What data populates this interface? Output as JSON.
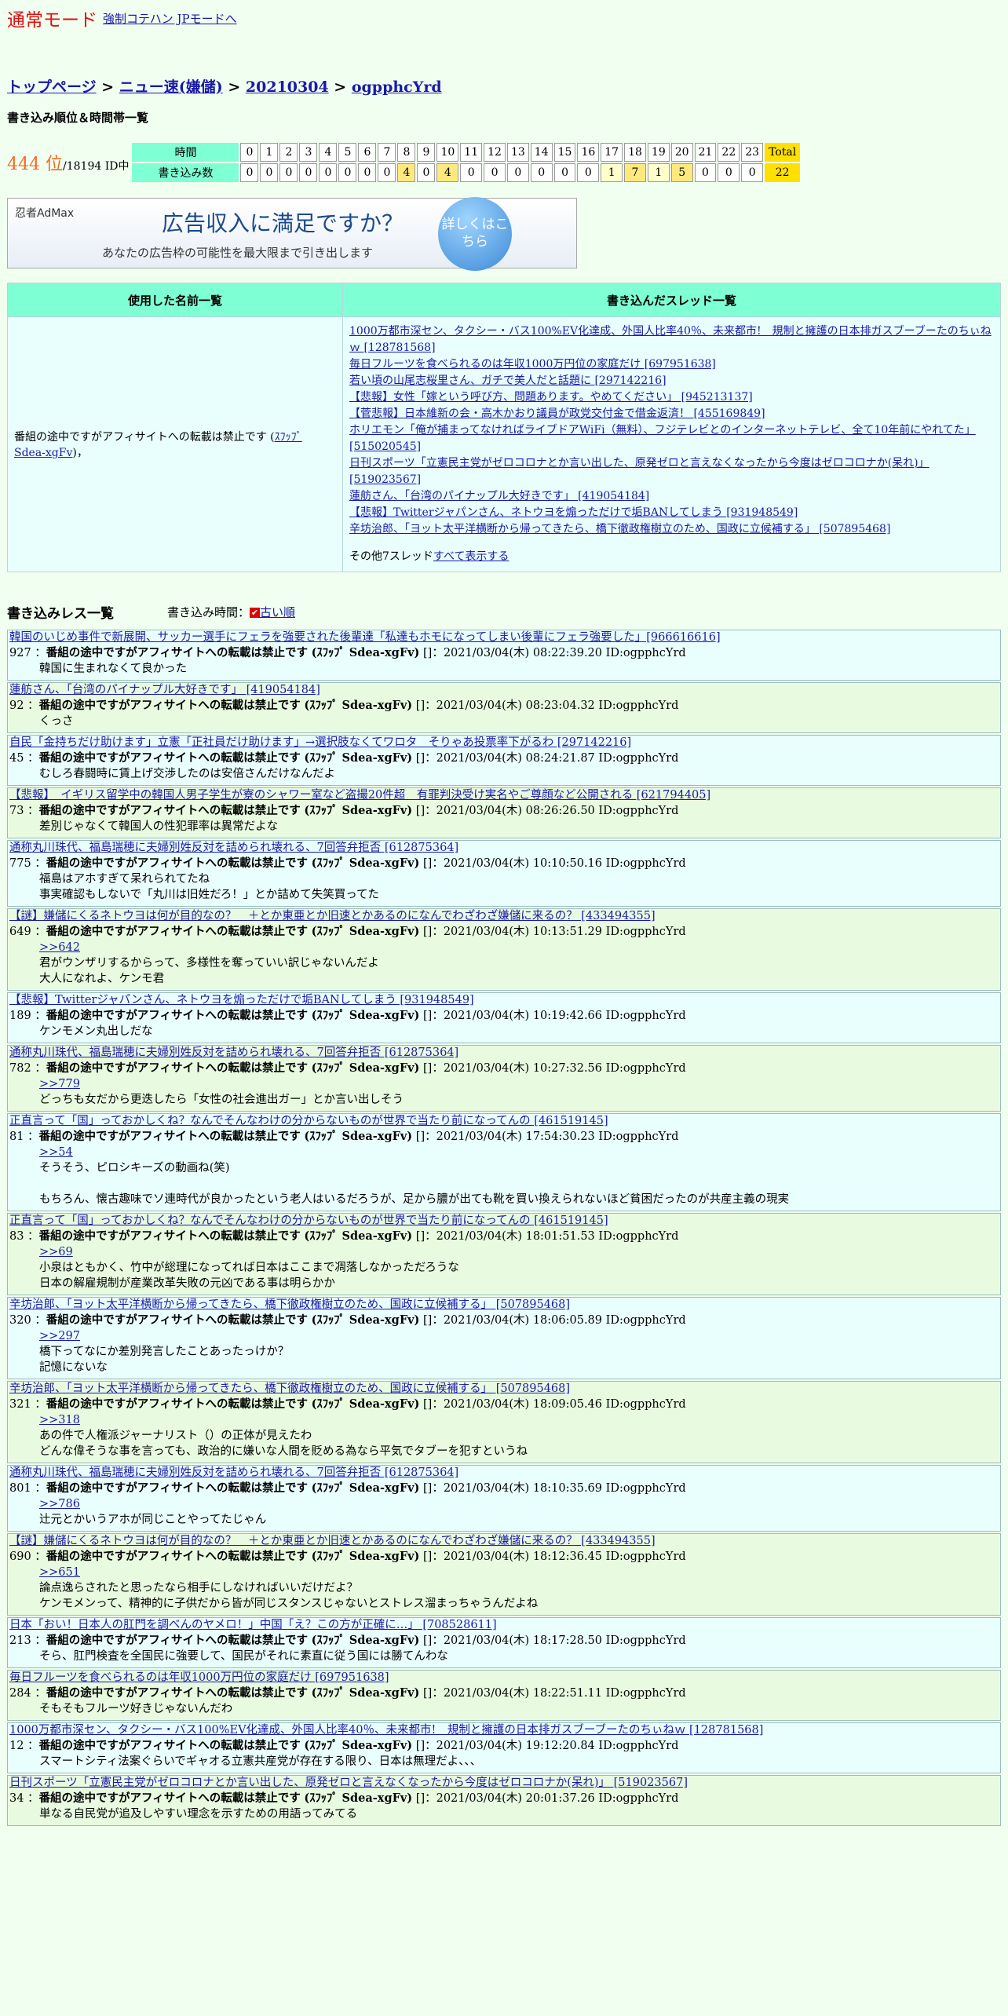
{
  "header": {
    "mode": "通常モード",
    "force_link": "強制コテハン JPモードへ"
  },
  "breadcrumb": {
    "top": "トップページ",
    "sep": " > ",
    "board": "ニュー速(嫌儲)",
    "date": "20210304",
    "id": "ogpphcYrd"
  },
  "ranking": {
    "title": "書き込み順位＆時間帯一覧",
    "position": "444 位",
    "total": "/18194 ID中",
    "label_time": "時間",
    "label_count": "書き込み数",
    "hours": [
      "0",
      "1",
      "2",
      "3",
      "4",
      "5",
      "6",
      "7",
      "8",
      "9",
      "10",
      "11",
      "12",
      "13",
      "14",
      "15",
      "16",
      "17",
      "18",
      "19",
      "20",
      "21",
      "22",
      "23",
      "Total"
    ],
    "counts": [
      "0",
      "0",
      "0",
      "0",
      "0",
      "0",
      "0",
      "0",
      "4",
      "0",
      "4",
      "0",
      "0",
      "0",
      "0",
      "0",
      "0",
      "1",
      "7",
      "1",
      "5",
      "0",
      "0",
      "0",
      "22"
    ]
  },
  "ad": {
    "logo": "忍者AdMax",
    "headline": "広告収入に満足ですか？",
    "sub": "あなたの広告枠の可能性を最大限まで引き出します",
    "button": "詳しくはこちら"
  },
  "names_table": {
    "col_names": "使用した名前一覧",
    "col_threads": "書き込んだスレッド一覧",
    "name": "番組の途中ですがアフィサイトへの転載は禁止です",
    "name_trip": "ｽﾌｯﾌﾟ Sdea-xgFv",
    "name_suffix": "，",
    "threads": [
      "1000万都市深セン、タクシー・バス100%EV化達成、外国人比率40％、未来都市!　規制と擁護の日本排ガスブーブーたのちぃねｗ [128781568]",
      "毎日フルーツを食べられるのは年収1000万円位の家庭だけ [697951638]",
      "若い頃の山尾志桜里さん、ガチで美人だと話題に [297142216]",
      "【悲報】女性「嫁という呼び方、問題あります。やめてください」 [945213137]",
      "【菅悲報】日本維新の会・高木かおり議員が政党交付金で借金返済！ [455169849]",
      "ホリエモン「俺が捕まってなければライブドアWiFi（無料）、フジテレビとのインターネットテレビ、全て10年前にやれてた」 [515020545]",
      "日刊スポーツ「立憲民主党がゼロコロナとか言い出した、原発ゼロと言えなくなったから今度はゼロコロナか(呆れ)」 [519023567]",
      "蓮舫さん、「台湾のパイナップル大好きです」 [419054184]",
      "【悲報】Twitterジャパンさん、ネトウヨを煽っただけで垢BANしてしまう [931948549]",
      "辛坊治郎、「ヨット太平洋横断から帰ってきたら、橋下徹政権樹立のため、国政に立候補する」 [507895468]"
    ],
    "other_prefix": "その他7スレッド",
    "other_link": "すべて表示する"
  },
  "reslist": {
    "title": "書き込みレス一覧",
    "order_label": "書き込み時間：",
    "order_icon": "✔",
    "order_link": "古い順"
  },
  "posts": [
    {
      "thread": "韓国のいじめ事件で新展開、サッカー選手にフェラを強要された後輩達「私達もホモになってしまい後輩にフェラ強要した」[966616616]",
      "no": "927",
      "name": "番組の途中ですがアフィサイトへの転載は禁止です",
      "trip": "(ｽﾌｯﾌﾟ Sdea-xgFv)",
      "meta": "[]：2021/03/04(木) 08:22:39.20 ID:ogpphcYrd",
      "anchor": "",
      "lines": [
        "韓国に生まれなくて良かった"
      ]
    },
    {
      "thread": "蓮舫さん、「台湾のパイナップル大好きです」 [419054184]",
      "no": "92",
      "name": "番組の途中ですがアフィサイトへの転載は禁止です",
      "trip": "(ｽﾌｯﾌﾟ Sdea-xgFv)",
      "meta": "[]：2021/03/04(木) 08:23:04.32 ID:ogpphcYrd",
      "anchor": "",
      "lines": [
        "くっさ"
      ]
    },
    {
      "thread": "自民「金持ちだけ助けます」立憲「正社員だけ助けます」→選択肢なくてワロタ　そりゃあ投票率下がるわ [297142216]",
      "no": "45",
      "name": "番組の途中ですがアフィサイトへの転載は禁止です",
      "trip": "(ｽﾌｯﾌﾟ Sdea-xgFv)",
      "meta": "[]：2021/03/04(木) 08:24:21.87 ID:ogpphcYrd",
      "anchor": "",
      "lines": [
        "むしろ春闘時に賃上げ交渉したのは安倍さんだけなんだよ"
      ]
    },
    {
      "thread": "【悲報】　イギリス留学中の韓国人男子学生が寮のシャワー室など盗撮20件超　有罪判決受け実名やご尊顔など公開される [621794405]",
      "no": "73",
      "name": "番組の途中ですがアフィサイトへの転載は禁止です",
      "trip": "(ｽﾌｯﾌﾟ Sdea-xgFv)",
      "meta": "[]：2021/03/04(木) 08:26:26.50 ID:ogpphcYrd",
      "anchor": "",
      "lines": [
        "差別じゃなくて韓国人の性犯罪率は異常だよな"
      ]
    },
    {
      "thread": "通称丸川珠代、福島瑞穂に夫婦別姓反対を詰められ壊れる、7回答弁拒否 [612875364]",
      "no": "775",
      "name": "番組の途中ですがアフィサイトへの転載は禁止です",
      "trip": "(ｽﾌｯﾌﾟ Sdea-xgFv)",
      "meta": "[]：2021/03/04(木) 10:10:50.16 ID:ogpphcYrd",
      "anchor": "",
      "lines": [
        "福島はアホすぎて呆れられてたね",
        "事実確認もしないで「丸川は旧姓だろ！」とか詰めて失笑買ってた"
      ]
    },
    {
      "thread": "【謎】嫌儲にくるネトウヨは何が目的なの？　＋とか東亜とか旧速とかあるのになんでわざわざ嫌儲に来るの？ [433494355]",
      "no": "649",
      "name": "番組の途中ですがアフィサイトへの転載は禁止です",
      "trip": "(ｽﾌｯﾌﾟ Sdea-xgFv)",
      "meta": "[]：2021/03/04(木) 10:13:51.29 ID:ogpphcYrd",
      "anchor": ">>642",
      "lines": [
        "君がウンザリするからって、多様性を奪っていい訳じゃないんだよ",
        "大人になれよ、ケンモ君"
      ]
    },
    {
      "thread": "【悲報】Twitterジャパンさん、ネトウヨを煽っただけで垢BANしてしまう [931948549]",
      "no": "189",
      "name": "番組の途中ですがアフィサイトへの転載は禁止です",
      "trip": "(ｽﾌｯﾌﾟ Sdea-xgFv)",
      "meta": "[]：2021/03/04(木) 10:19:42.66 ID:ogpphcYrd",
      "anchor": "",
      "lines": [
        "ケンモメン丸出しだな"
      ]
    },
    {
      "thread": "通称丸川珠代、福島瑞穂に夫婦別姓反対を詰められ壊れる、7回答弁拒否 [612875364]",
      "no": "782",
      "name": "番組の途中ですがアフィサイトへの転載は禁止です",
      "trip": "(ｽﾌｯﾌﾟ Sdea-xgFv)",
      "meta": "[]：2021/03/04(木) 10:27:32.56 ID:ogpphcYrd",
      "anchor": ">>779",
      "lines": [
        "どっちも女だから更迭したら「女性の社会進出ガー」とか言い出しそう"
      ]
    },
    {
      "thread": "正直言って「国」っておかしくね？なんでそんなわけの分からないものが世界で当たり前になってんの [461519145]",
      "no": "81",
      "name": "番組の途中ですがアフィサイトへの転載は禁止です",
      "trip": "(ｽﾌｯﾌﾟ Sdea-xgFv)",
      "meta": "[]：2021/03/04(木) 17:54:30.23 ID:ogpphcYrd",
      "anchor": ">>54",
      "lines": [
        "そうそう、ピロシキーズの動画ね(笑)",
        "",
        "もちろん、懐古趣味でソ連時代が良かったという老人はいるだろうが、足から膿が出ても靴を買い換えられないほど貧困だったのが共産主義の現実"
      ]
    },
    {
      "thread": "正直言って「国」っておかしくね？なんでそんなわけの分からないものが世界で当たり前になってんの [461519145]",
      "no": "83",
      "name": "番組の途中ですがアフィサイトへの転載は禁止です",
      "trip": "(ｽﾌｯﾌﾟ Sdea-xgFv)",
      "meta": "[]：2021/03/04(木) 18:01:51.53 ID:ogpphcYrd",
      "anchor": ">>69",
      "lines": [
        "小泉はともかく、竹中が総理になってれば日本はここまで凋落しなかっただろうな",
        "日本の解雇規制が産業改革失敗の元凶である事は明らかか"
      ]
    },
    {
      "thread": "辛坊治郎、「ヨット太平洋横断から帰ってきたら、橋下徹政権樹立のため、国政に立候補する」 [507895468]",
      "no": "320",
      "name": "番組の途中ですがアフィサイトへの転載は禁止です",
      "trip": "(ｽﾌｯﾌﾟ Sdea-xgFv)",
      "meta": "[]：2021/03/04(木) 18:06:05.89 ID:ogpphcYrd",
      "anchor": ">>297",
      "lines": [
        "橋下ってなにか差別発言したことあったっけか？",
        "記憶にないな"
      ]
    },
    {
      "thread": "辛坊治郎、「ヨット太平洋横断から帰ってきたら、橋下徹政権樹立のため、国政に立候補する」 [507895468]",
      "no": "321",
      "name": "番組の途中ですがアフィサイトへの転載は禁止です",
      "trip": "(ｽﾌｯﾌﾟ Sdea-xgFv)",
      "meta": "[]：2021/03/04(木) 18:09:05.46 ID:ogpphcYrd",
      "anchor": ">>318",
      "lines": [
        "あの件で人権派ジャーナリスト（）の正体が見えたわ",
        "どんな偉そうな事を言っても、政治的に嫌いな人間を貶める為なら平気でタブーを犯すというね"
      ]
    },
    {
      "thread": "通称丸川珠代、福島瑞穂に夫婦別姓反対を詰められ壊れる、7回答弁拒否 [612875364]",
      "no": "801",
      "name": "番組の途中ですがアフィサイトへの転載は禁止です",
      "trip": "(ｽﾌｯﾌﾟ Sdea-xgFv)",
      "meta": "[]：2021/03/04(木) 18:10:35.69 ID:ogpphcYrd",
      "anchor": ">>786",
      "lines": [
        "辻元とかいうアホが同じことやってたじゃん"
      ]
    },
    {
      "thread": "【謎】嫌儲にくるネトウヨは何が目的なの？　＋とか東亜とか旧速とかあるのになんでわざわざ嫌儲に来るの？ [433494355]",
      "no": "690",
      "name": "番組の途中ですがアフィサイトへの転載は禁止です",
      "trip": "(ｽﾌｯﾌﾟ Sdea-xgFv)",
      "meta": "[]：2021/03/04(木) 18:12:36.45 ID:ogpphcYrd",
      "anchor": ">>651",
      "lines": [
        "論点逸らされたと思ったなら相手にしなければいいだけだよ？",
        "ケンモメンって、精神的に子供だから皆が同じスタンスじゃないとストレス溜まっちゃうんだよね"
      ]
    },
    {
      "thread": "日本「おい！日本人の肛門を調べんのヤメロ！」中国「え？この方が正確に…」 [708528611]",
      "no": "213",
      "name": "番組の途中ですがアフィサイトへの転載は禁止です",
      "trip": "(ｽﾌｯﾌﾟ Sdea-xgFv)",
      "meta": "[]：2021/03/04(木) 18:17:28.50 ID:ogpphcYrd",
      "anchor": "",
      "lines": [
        "そら、肛門検査を全国民に強要して、国民がそれに素直に従う国には勝てんわな"
      ]
    },
    {
      "thread": "毎日フルーツを食べられるのは年収1000万円位の家庭だけ [697951638]",
      "no": "284",
      "name": "番組の途中ですがアフィサイトへの転載は禁止です",
      "trip": "(ｽﾌｯﾌﾟ Sdea-xgFv)",
      "meta": "[]：2021/03/04(木) 18:22:51.11 ID:ogpphcYrd",
      "anchor": "",
      "lines": [
        "そもそもフルーツ好きじゃないんだわ"
      ]
    },
    {
      "thread": "1000万都市深セン、タクシー・バス100%EV化達成、外国人比率40％、未来都市!　規制と擁護の日本排ガスブーブーたのちぃねｗ [128781568]",
      "no": "12",
      "name": "番組の途中ですがアフィサイトへの転載は禁止です",
      "trip": "(ｽﾌｯﾌﾟ Sdea-xgFv)",
      "meta": "[]：2021/03/04(木) 19:12:20.84 ID:ogpphcYrd",
      "anchor": "",
      "lines": [
        "スマートシティ法案ぐらいでギャオる立憲共産党が存在する限り、日本は無理だよ、、、"
      ]
    },
    {
      "thread": "日刊スポーツ「立憲民主党がゼロコロナとか言い出した、原発ゼロと言えなくなったから今度はゼロコロナか(呆れ)」 [519023567]",
      "no": "34",
      "name": "番組の途中ですがアフィサイトへの転載は禁止です",
      "trip": "(ｽﾌｯﾌﾟ Sdea-xgFv)",
      "meta": "[]：2021/03/04(木) 20:01:37.26 ID:ogpphcYrd",
      "anchor": "",
      "lines": [
        "単なる自民党が追及しやすい理念を示すための用語ってみてる"
      ]
    }
  ]
}
